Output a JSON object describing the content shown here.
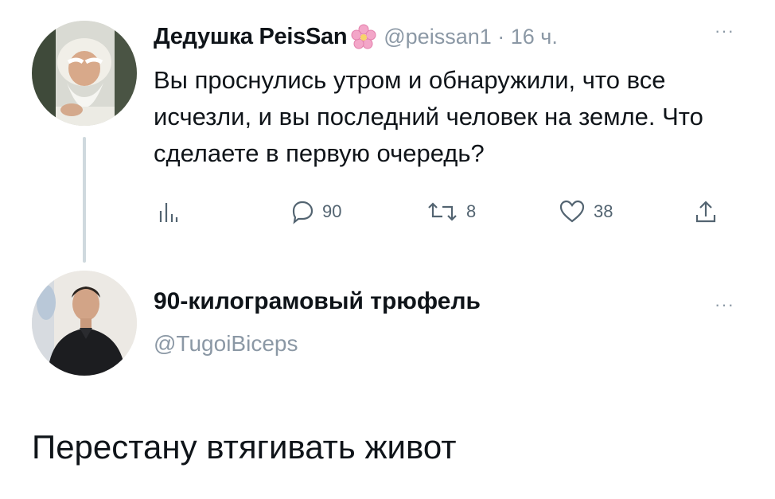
{
  "tweet1": {
    "author_name": "Дедушка PeisSan",
    "author_emoji": "cherry-blossom-icon",
    "handle_time": "@peissan1 · 16 ч.",
    "more": "···",
    "text": "Вы проснулись утром и обнаружили, что все исчезли, и вы последний человек на земле. Что сделаете в первую очередь?",
    "actions": {
      "analytics_icon": "bar-chart-icon",
      "replies": "90",
      "retweets": "8",
      "likes": "38",
      "share_icon": "share-icon"
    }
  },
  "tweet2": {
    "author_name": "90-килограмовый трюфель",
    "handle": "@TugoiBiceps",
    "more": "···",
    "text": "Перестану втягивать живот"
  },
  "colors": {
    "text": "#0f1419",
    "secondary": "#8b98a5",
    "icon": "#536471",
    "thread_line": "#cfd9de"
  }
}
